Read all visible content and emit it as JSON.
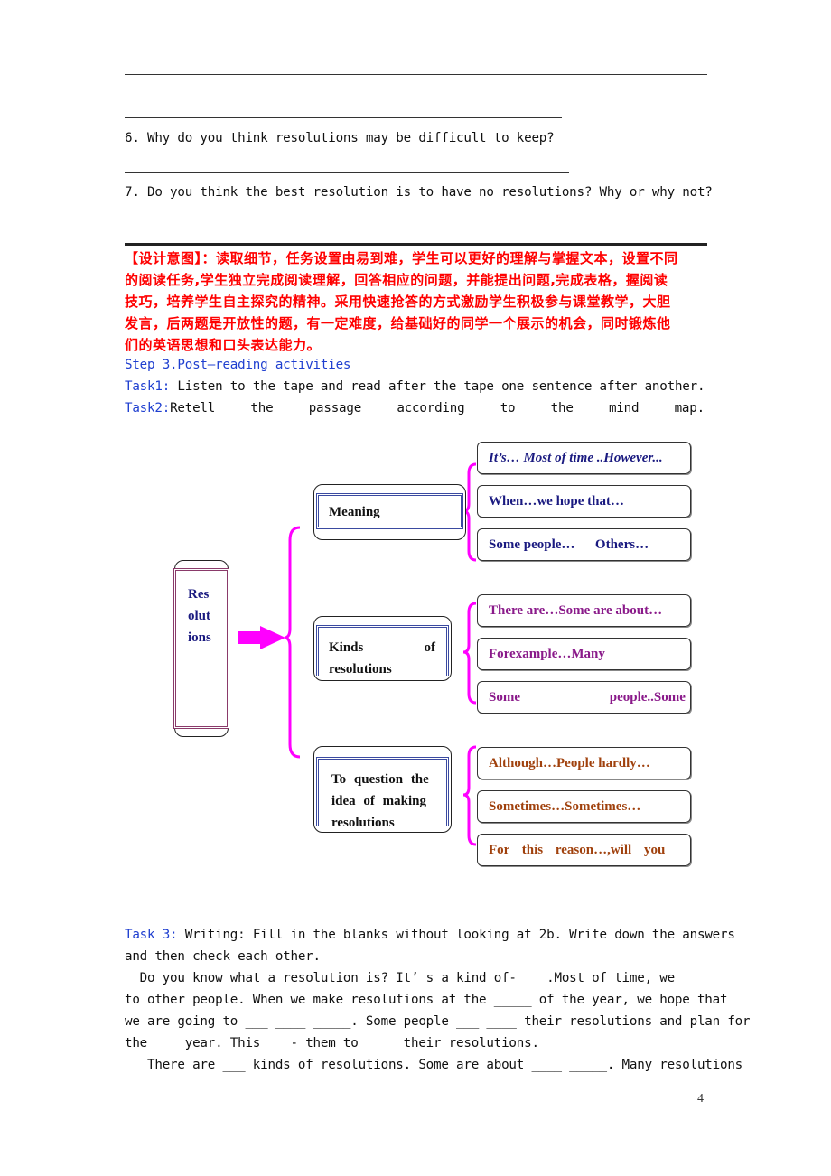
{
  "questions": {
    "q6": "6.  Why do you think resolutions may be difficult to keep?",
    "q7": "7.  Do you think the best resolution is to have no resolutions? Why or why not?"
  },
  "design_intent": {
    "lines": [
      "【设计意图】：读取细节，任务设置由易到难，学生可以更好的理解与掌握文本，设置不同",
      "的阅读任务,学生独立完成阅读理解，回答相应的问题，并能提出问题,完成表格，握阅读",
      "技巧，培养学生自主探究的精神。采用快速抢答的方式激励学生积极参与课堂教学，大胆",
      "发言，后两题是开放性的题，有一定难度，给基础好的同学一个展示的机会，同时锻炼他",
      "们的英语思想和口头表达能力。"
    ],
    "color": "#ff0000"
  },
  "step3": {
    "title": "Step 3.Post—reading activities",
    "task1_label": "Task1:",
    "task1_text": " Listen to the tape and read after the tape one sentence after another.",
    "task2_label": "Task2:",
    "task2_words": [
      "Retell",
      "the",
      "passage",
      "according",
      "to",
      "the",
      "mind",
      "map."
    ]
  },
  "mindmap": {
    "root": {
      "lines": [
        "Res",
        "olut",
        "ions"
      ]
    },
    "branches": [
      {
        "label": "Meaning",
        "leaves": [
          "It’s… Most of time ..However...",
          "When…we hope that…",
          "Some people…      Others…"
        ],
        "color": "#1a1a80"
      },
      {
        "label_lines": [
          "Kinds",
          "of",
          "resolutions"
        ],
        "leaves": [
          "There are…Some are about…",
          "Forexample…Many",
          "Some people..Some"
        ],
        "color": "#8a1a8a"
      },
      {
        "label_lines": [
          "To  question  the",
          "idea  of  making",
          "resolutions"
        ],
        "leaves": [
          "Although…People hardly…",
          "Sometimes…Sometimes…",
          "For this reason…,will you"
        ],
        "color": "#a0410d"
      }
    ],
    "connector_color": "#ff00ff"
  },
  "task3": {
    "label": "Task 3:",
    "text1": " Writing: Fill in the blanks without looking at 2b. Write down the answers",
    "text2": "and then check each other.",
    "p1": [
      "  Do you know what a resolution is? It’ s a kind of-___ .Most of time, we ___ ___",
      "to other people. When we make resolutions at the _____ of the year, we hope that",
      "we are going to ___ ____ _____. Some people ___ ____ their resolutions and plan for",
      "the ___ year. This ___- them to ____ their resolutions."
    ],
    "p2": "   There are ___ kinds of resolutions. Some are about ____ _____. Many resolutions"
  },
  "page_number": "4"
}
